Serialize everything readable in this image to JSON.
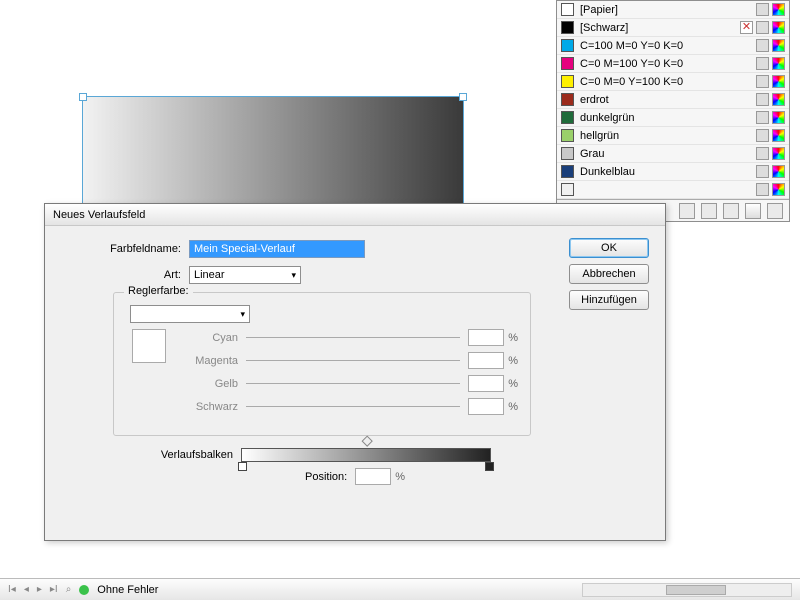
{
  "swatches": {
    "items": [
      {
        "name": "[Papier]",
        "color": "#ffffff"
      },
      {
        "name": "[Schwarz]",
        "color": "#000000"
      },
      {
        "name": "C=100 M=0 Y=0 K=0",
        "color": "#00a9e8"
      },
      {
        "name": "C=0 M=100 Y=0 K=0",
        "color": "#e5007e"
      },
      {
        "name": "C=0 M=0 Y=100 K=0",
        "color": "#fff000"
      },
      {
        "name": "erdrot",
        "color": "#9b2b1c"
      },
      {
        "name": "dunkelgrün",
        "color": "#1f6b3a"
      },
      {
        "name": "hellgrün",
        "color": "#9ad06a"
      },
      {
        "name": "Grau",
        "color": "#c8c8c8"
      },
      {
        "name": "Dunkelblau",
        "color": "#1a3f7a"
      },
      {
        "name": "",
        "color": "#f0f0f0"
      }
    ]
  },
  "dialog": {
    "title": "Neues Verlaufsfeld",
    "name_label": "Farbfeldname:",
    "name_value": "Mein Special-Verlauf",
    "type_label": "Art:",
    "type_value": "Linear",
    "stopcolor_label": "Reglerfarbe:",
    "cmyk": {
      "c": "Cyan",
      "m": "Magenta",
      "y": "Gelb",
      "k": "Schwarz"
    },
    "pct": "%",
    "gradbar_label": "Verlaufsbalken",
    "position_label": "Position:",
    "buttons": {
      "ok": "OK",
      "cancel": "Abbrechen",
      "add": "Hinzufügen"
    }
  },
  "status": {
    "text": "Ohne Fehler"
  }
}
